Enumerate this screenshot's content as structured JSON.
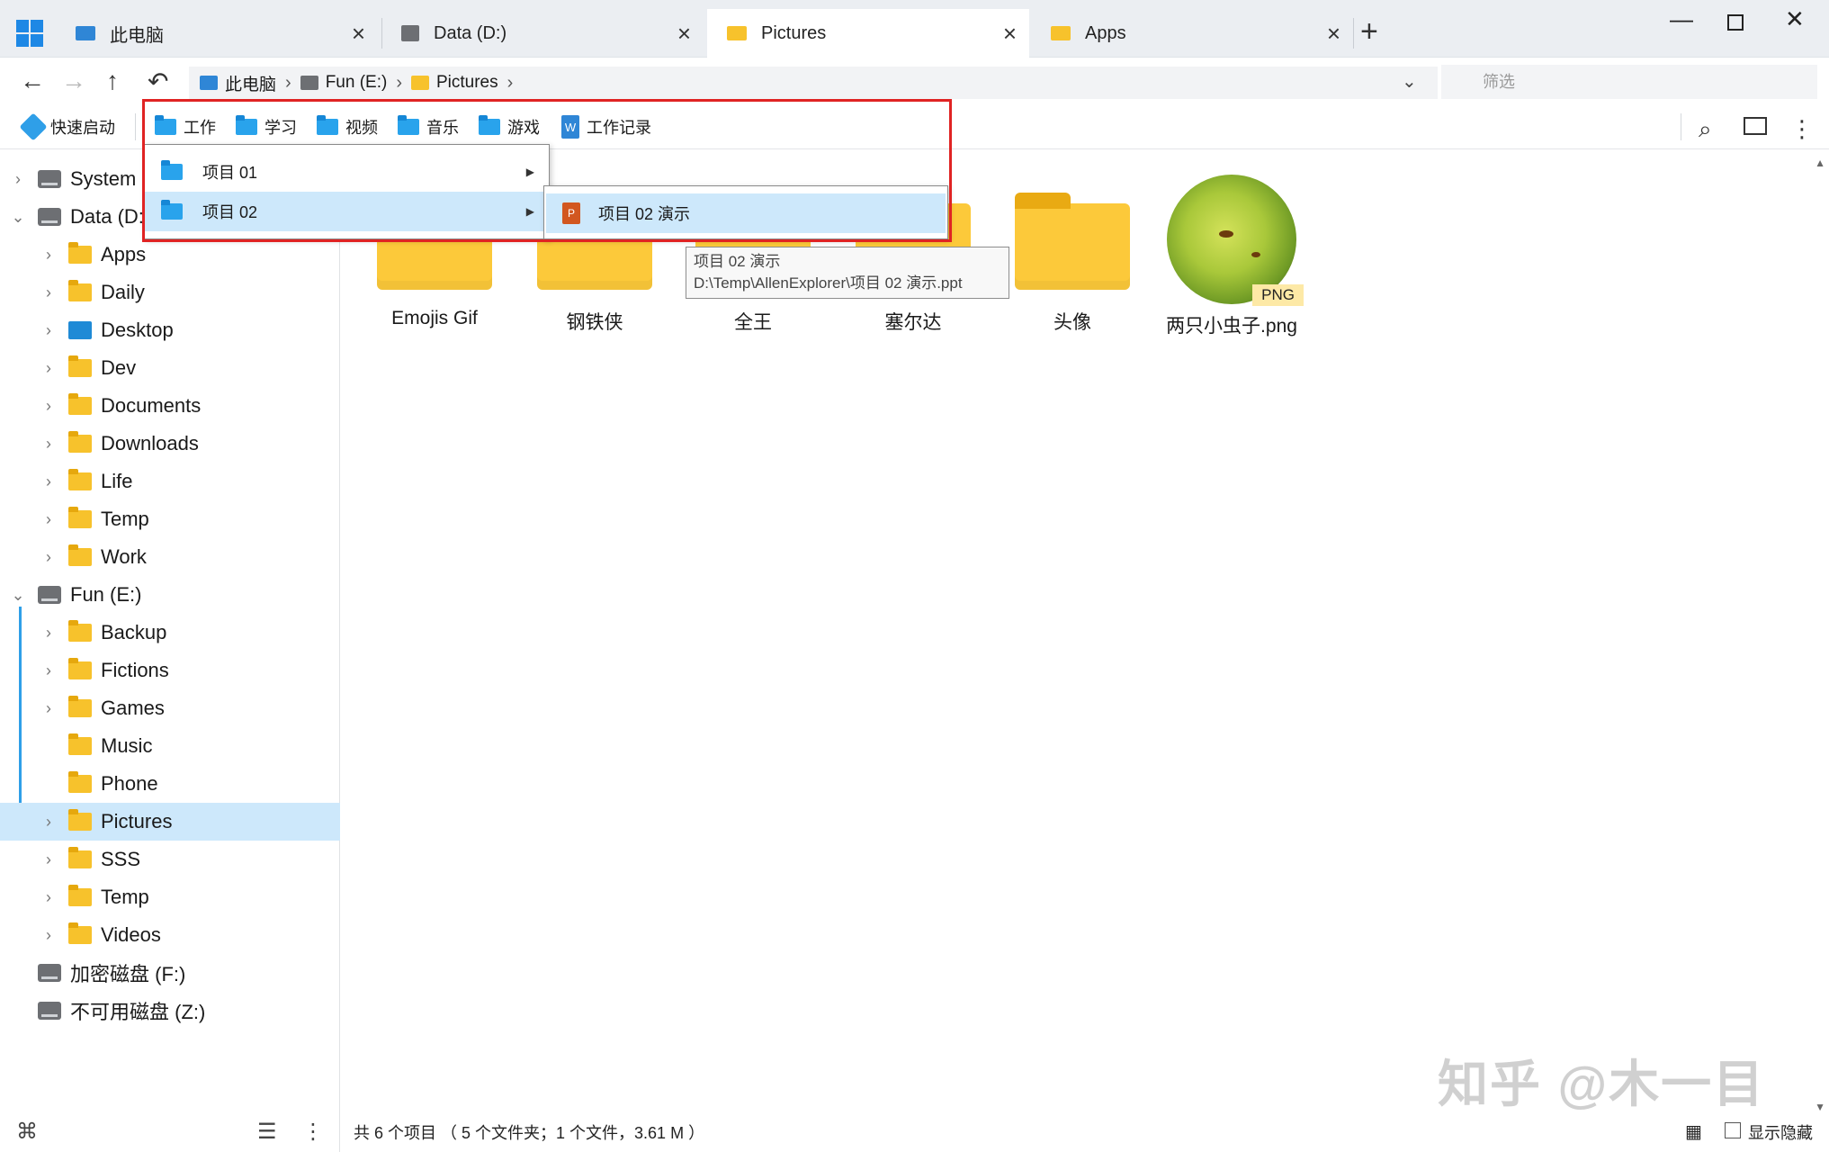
{
  "tabs": [
    {
      "label": "此电脑",
      "icon": "computer-icon",
      "active": false
    },
    {
      "label": "Data (D:)",
      "icon": "drive-icon",
      "active": false
    },
    {
      "label": "Pictures",
      "icon": "pictures-folder-icon",
      "active": true
    },
    {
      "label": "Apps",
      "icon": "folder-icon",
      "active": false
    }
  ],
  "breadcrumb": [
    {
      "label": "此电脑",
      "icon": "computer-icon"
    },
    {
      "label": "Fun (E:)",
      "icon": "drive-icon"
    },
    {
      "label": "Pictures",
      "icon": "pictures-folder-icon"
    }
  ],
  "filter": {
    "placeholder": "筛选"
  },
  "quick_toolbar": {
    "quick_start": "快速启动",
    "items": [
      "工作",
      "学习",
      "视频",
      "音乐",
      "游戏",
      "工作记录"
    ]
  },
  "menu": {
    "items": [
      {
        "label": "项目 01"
      },
      {
        "label": "项目 02"
      }
    ],
    "submenu": [
      {
        "label": "项目 02 演示"
      }
    ]
  },
  "tooltip": {
    "line1": "项目 02 演示",
    "line2": "D:\\Temp\\AllenExplorer\\项目 02 演示.ppt"
  },
  "sidebar": {
    "nodes": [
      {
        "label": "System",
        "type": "drive"
      },
      {
        "label": "Data (D:)",
        "type": "drive"
      },
      {
        "label": "Apps"
      },
      {
        "label": "Daily"
      },
      {
        "label": "Desktop"
      },
      {
        "label": "Dev"
      },
      {
        "label": "Documents"
      },
      {
        "label": "Downloads"
      },
      {
        "label": "Life"
      },
      {
        "label": "Temp"
      },
      {
        "label": "Work"
      },
      {
        "label": "Fun (E:)",
        "type": "drive"
      },
      {
        "label": "Backup"
      },
      {
        "label": "Fictions"
      },
      {
        "label": "Games"
      },
      {
        "label": "Music"
      },
      {
        "label": "Phone"
      },
      {
        "label": "Pictures",
        "selected": true
      },
      {
        "label": "SSS"
      },
      {
        "label": "Temp"
      },
      {
        "label": "Videos"
      },
      {
        "label": "加密磁盘 (F:)",
        "type": "drive"
      },
      {
        "label": "不可用磁盘 (Z:)",
        "type": "drive"
      }
    ]
  },
  "content": {
    "items": [
      {
        "label": "Emojis Gif",
        "type": "folder"
      },
      {
        "label": "钢铁侠",
        "type": "folder"
      },
      {
        "label": "全王",
        "type": "folder"
      },
      {
        "label": "塞尔达",
        "type": "folder"
      },
      {
        "label": "头像",
        "type": "folder"
      },
      {
        "label": "两只小虫子.png",
        "type": "image",
        "badge": "PNG"
      }
    ]
  },
  "status": {
    "summary": "共 6 个项目 （ 5 个文件夹；1 个文件，3.61 M ）",
    "show_hidden": "显示隐藏"
  },
  "watermark": "知乎 @木一目",
  "colors": {
    "accent": "#2f9fe8",
    "selection": "#cde8fb",
    "folder": "#fcc93a",
    "highlight_box": "#e02323"
  }
}
